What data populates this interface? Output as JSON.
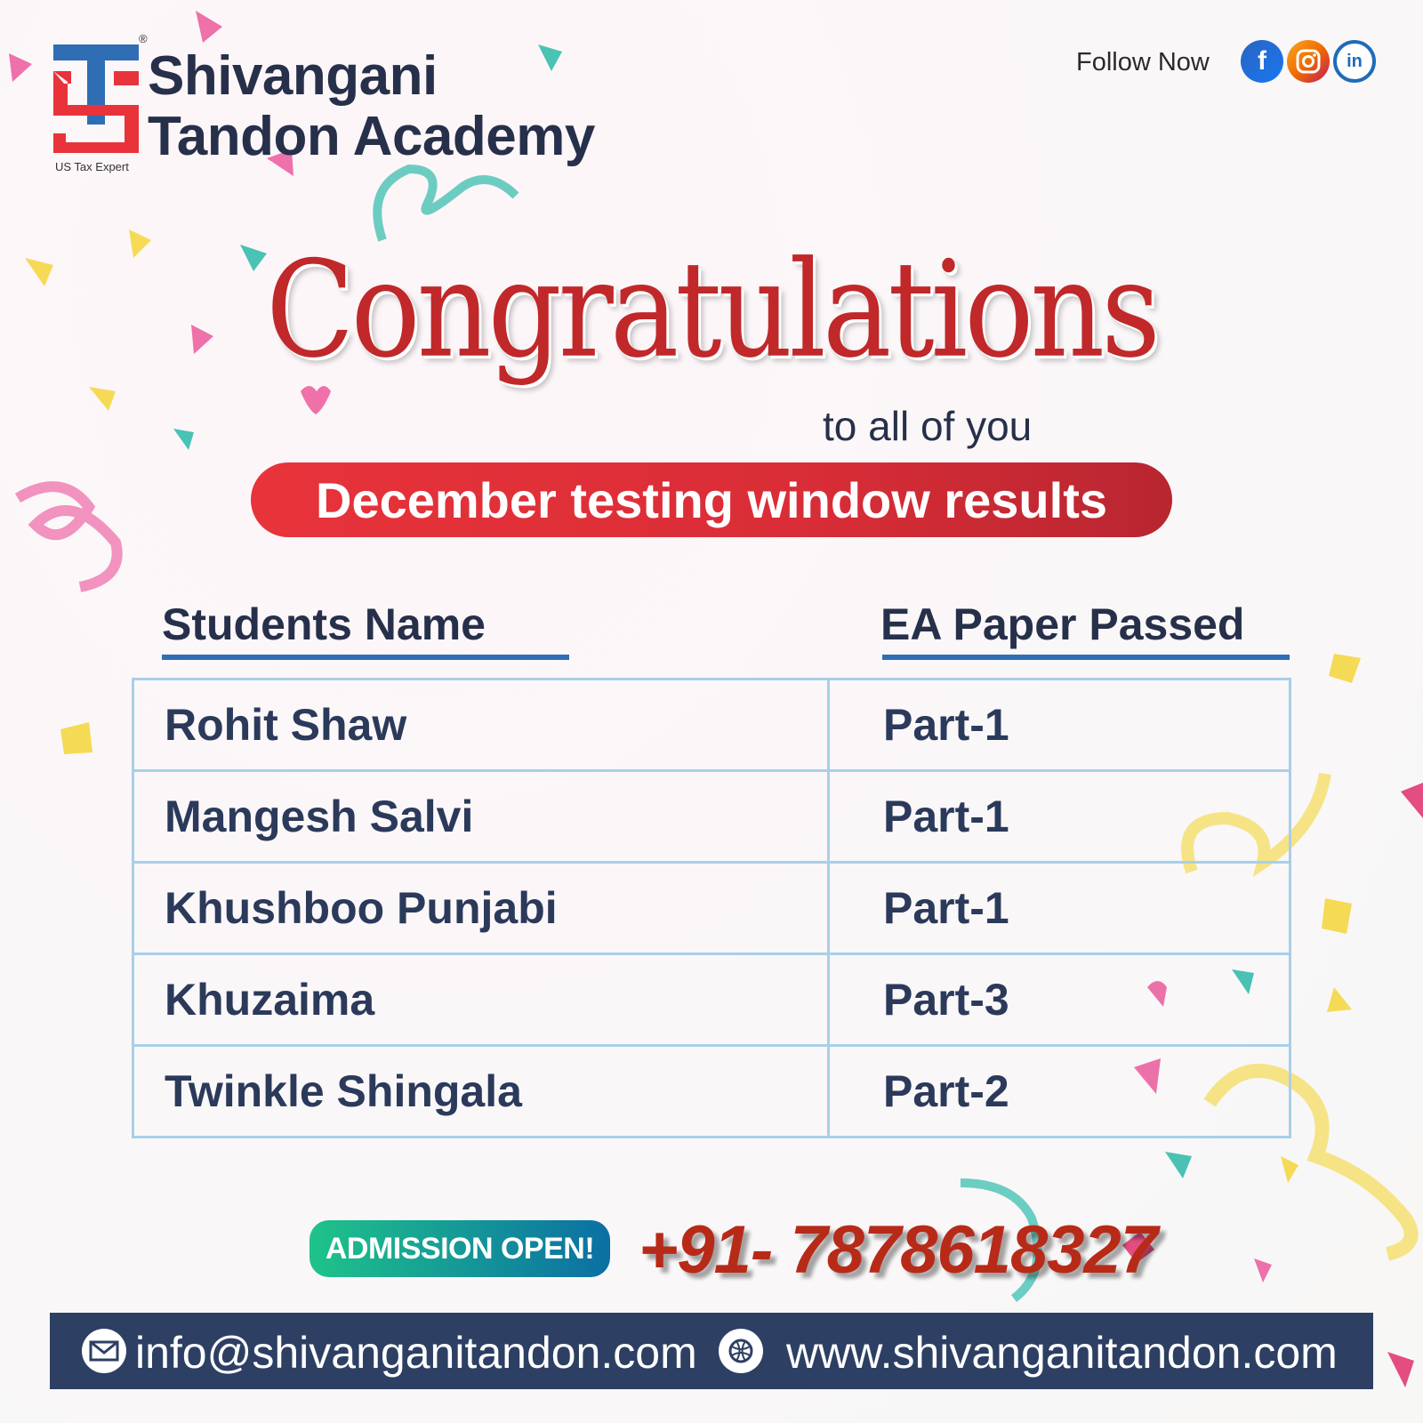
{
  "brand": {
    "name_line1": "Shivangani",
    "name_line2": "Tandon Academy",
    "registered_mark": "®",
    "tagline": "US Tax Expert",
    "colors": {
      "primary_blue": "#2f6db5",
      "primary_red": "#e8333a",
      "navy": "#27304a"
    }
  },
  "social": {
    "label": "Follow Now",
    "icons": [
      {
        "name": "facebook-icon",
        "glyph": "f"
      },
      {
        "name": "instagram-icon",
        "glyph": "◎"
      },
      {
        "name": "linkedin-icon",
        "glyph": "in"
      }
    ]
  },
  "headline": {
    "title": "Congratulations",
    "subtitle": "to all of you",
    "banner": "December testing window results"
  },
  "results": {
    "headers": [
      "Students Name",
      "EA Paper Passed"
    ],
    "rows": [
      [
        "Rohit Shaw",
        "Part-1"
      ],
      [
        "Mangesh Salvi",
        "Part-1"
      ],
      [
        "Khushboo Punjabi",
        "Part-1"
      ],
      [
        "Khuzaima",
        "Part-3"
      ],
      [
        "Twinkle Shingala",
        "Part-2"
      ]
    ]
  },
  "cta": {
    "admission": "ADMISSION OPEN!",
    "phone": "+91- 7878618327"
  },
  "footer": {
    "email": "info@shivanganitandon.com",
    "website": "www.shivanganitandon.com"
  }
}
